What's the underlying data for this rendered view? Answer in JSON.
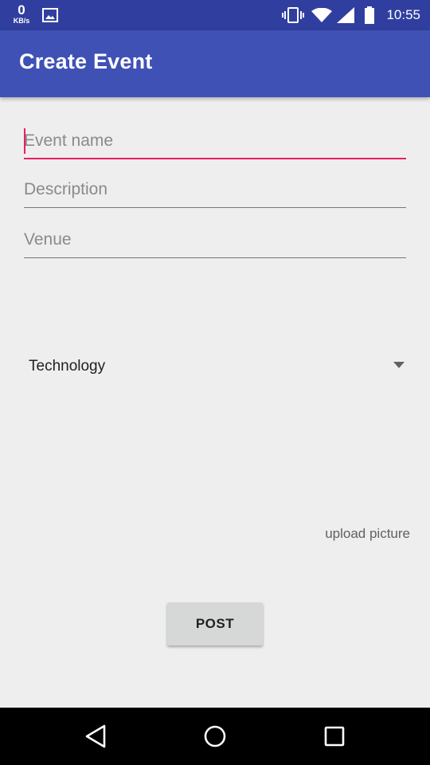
{
  "status_bar": {
    "speed_value": "0",
    "speed_unit": "KB/s",
    "time": "10:55",
    "icons": [
      "image-icon",
      "vibrate-icon",
      "wifi-icon",
      "signal-icon",
      "battery-icon"
    ]
  },
  "app_bar": {
    "title": "Create Event"
  },
  "form": {
    "event_name": {
      "placeholder": "Event name",
      "value": ""
    },
    "description": {
      "placeholder": "Description",
      "value": ""
    },
    "venue": {
      "placeholder": "Venue",
      "value": ""
    },
    "category": {
      "selected": "Technology"
    },
    "upload_label": "upload picture",
    "post_label": "POST"
  },
  "nav_bar": {
    "icons": [
      "back-icon",
      "home-icon",
      "recents-icon"
    ]
  },
  "colors": {
    "status_bar": "#303F9F",
    "app_bar": "#3F51B5",
    "accent": "#E91E63",
    "background": "#EEEEEE"
  }
}
